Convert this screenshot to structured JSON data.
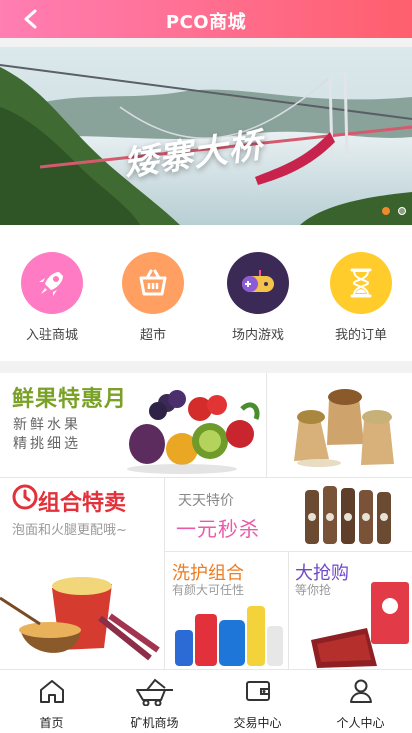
{
  "header": {
    "title": "PCO商城",
    "back_icon": "back-icon"
  },
  "banner": {
    "caption": "矮寨大桥",
    "active_slide": 1,
    "slides": 2
  },
  "quick_menu": [
    {
      "label": "入驻商城",
      "icon": "rocket-icon",
      "color": "#ff7bc4"
    },
    {
      "label": "超市",
      "icon": "basket-icon",
      "color": "#ff9f61"
    },
    {
      "label": "场内游戏",
      "icon": "gamepad-icon",
      "color": "#3b2a55"
    },
    {
      "label": "我的订单",
      "icon": "hourglass-icon",
      "color": "#ffcc2b"
    }
  ],
  "promos": {
    "fruit": {
      "title": "鲜果特惠月",
      "sub1": "新鲜水果",
      "sub2": "精挑细选"
    },
    "combo": {
      "title": "组合特卖",
      "sub": "泡面和火腿更配哦~"
    },
    "daily": {
      "title": "天天特价",
      "big": "一元秒杀"
    },
    "wash": {
      "title": "洗护组合",
      "sub": "有颜大可任性"
    },
    "grab": {
      "title": "大抢购",
      "sub": "等你抢"
    }
  },
  "tabbar": [
    {
      "label": "首页",
      "icon": "home-icon"
    },
    {
      "label": "矿机商场",
      "icon": "mining-cart-icon"
    },
    {
      "label": "交易中心",
      "icon": "wallet-icon"
    },
    {
      "label": "个人中心",
      "icon": "user-icon"
    }
  ]
}
